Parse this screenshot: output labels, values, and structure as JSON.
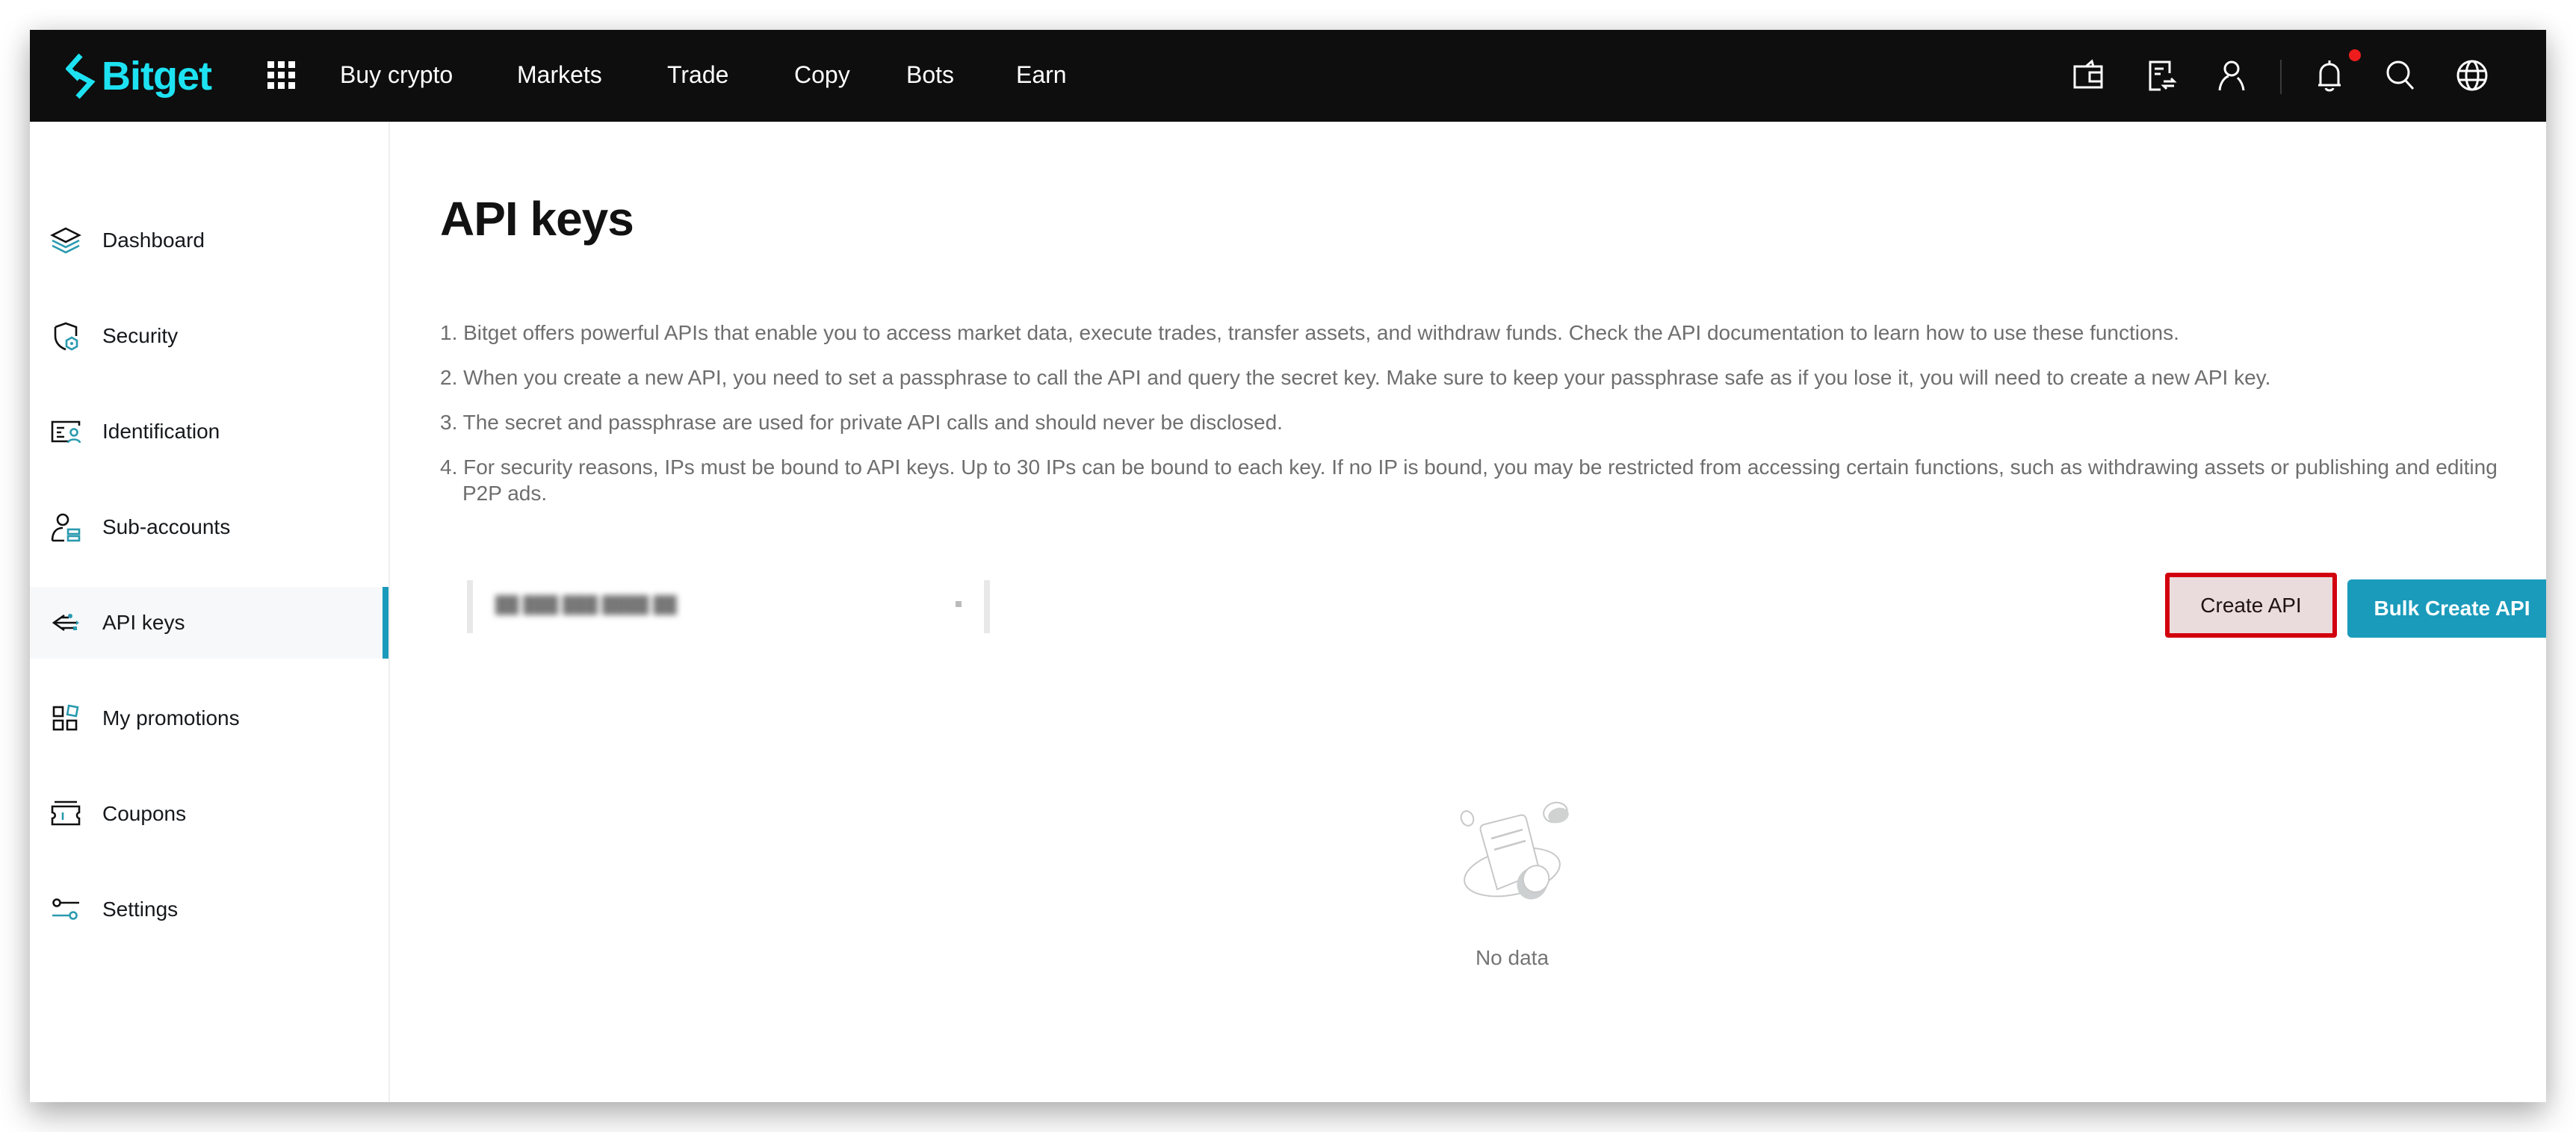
{
  "header": {
    "brand": "Bitget",
    "nav": [
      "Buy crypto",
      "Markets",
      "Trade",
      "Copy",
      "Bots",
      "Earn"
    ],
    "icons": [
      "wallet-icon",
      "orders-icon",
      "user-icon",
      "bell-icon",
      "search-icon",
      "globe-icon"
    ],
    "has_notification": true
  },
  "sidebar": {
    "items": [
      {
        "label": "Dashboard",
        "icon": "layers-icon",
        "active": false
      },
      {
        "label": "Security",
        "icon": "shield-icon",
        "active": false
      },
      {
        "label": "Identification",
        "icon": "id-card-icon",
        "active": false
      },
      {
        "label": "Sub-accounts",
        "icon": "sub-accounts-icon",
        "active": false
      },
      {
        "label": "API keys",
        "icon": "api-icon",
        "active": true
      },
      {
        "label": "My promotions",
        "icon": "promotions-icon",
        "active": false
      },
      {
        "label": "Coupons",
        "icon": "coupon-icon",
        "active": false
      },
      {
        "label": "Settings",
        "icon": "settings-sliders-icon",
        "active": false
      }
    ]
  },
  "main": {
    "title": "API keys",
    "info": [
      "1. Bitget offers powerful APIs that enable you to access market data, execute trades, transfer assets, and withdraw funds. Check the API documentation to learn how to use these functions.",
      "2. When you create a new API, you need to set a passphrase to call the API and query the secret key. Make sure to keep your passphrase safe as if you lose it, you will need to create a new API key.",
      "3. The secret and passphrase are used for private API calls and should never be disclosed.",
      "4. For security reasons, IPs must be bound to API keys. Up to 30 IPs can be bound to each key. If no IP is bound, you may be restricted from accessing certain functions, such as withdrawing assets or publishing and editing P2P ads."
    ],
    "filter": {
      "value": "██ ███ ███ ████ ██"
    },
    "buttons": {
      "create": "Create API",
      "bulk_create": "Bulk Create API"
    },
    "empty_text": "No data"
  },
  "colors": {
    "accent": "#1a9bbb",
    "brand": "#1de2f2",
    "header_bg": "#0e0e0e",
    "highlight_border": "#d2000e",
    "notification": "#ee1c1c"
  }
}
